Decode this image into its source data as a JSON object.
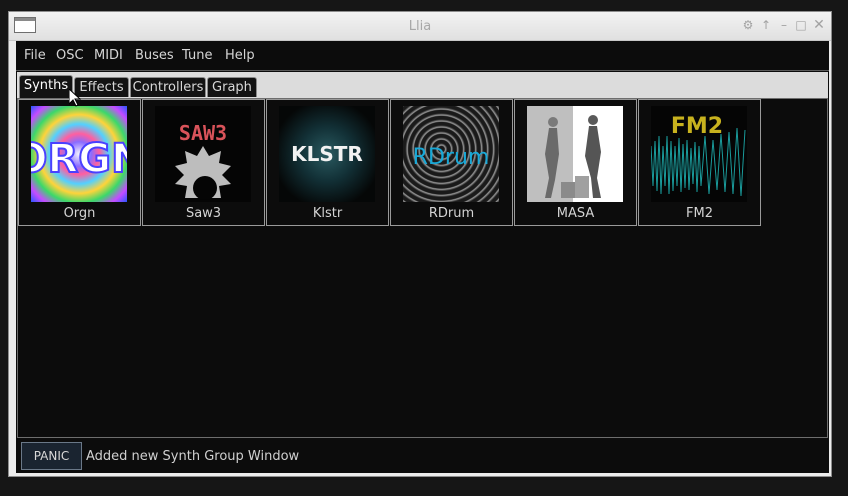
{
  "window": {
    "title": "Llia"
  },
  "menu": [
    "File",
    "OSC",
    "MIDI",
    "Buses",
    "Tune",
    "Help"
  ],
  "tabs": [
    "Synths",
    "Effects",
    "Controllers",
    "Graph"
  ],
  "synths": [
    {
      "label": "Orgn",
      "logo_text": "ORGN"
    },
    {
      "label": "Saw3",
      "logo_text": "SAW3"
    },
    {
      "label": "Klstr",
      "logo_text": "KLSTR"
    },
    {
      "label": "RDrum",
      "logo_text": "RDrum"
    },
    {
      "label": "MASA"
    },
    {
      "label": "FM2",
      "logo_text": "FM2"
    }
  ],
  "status": {
    "panic_label": "PANIC",
    "message": "Added new Synth Group Window"
  },
  "colors": {
    "rdrum_text": "#19a9d8",
    "fm2_text": "#c8b21e",
    "fm2_wave": "#1a9c9c",
    "saw3_text": "#d9535a"
  },
  "icons": [
    "app-window-icon",
    "settings-icon",
    "up-arrow-icon",
    "minimize-icon",
    "maximize-icon",
    "close-icon",
    "mouse-pointer-icon"
  ]
}
